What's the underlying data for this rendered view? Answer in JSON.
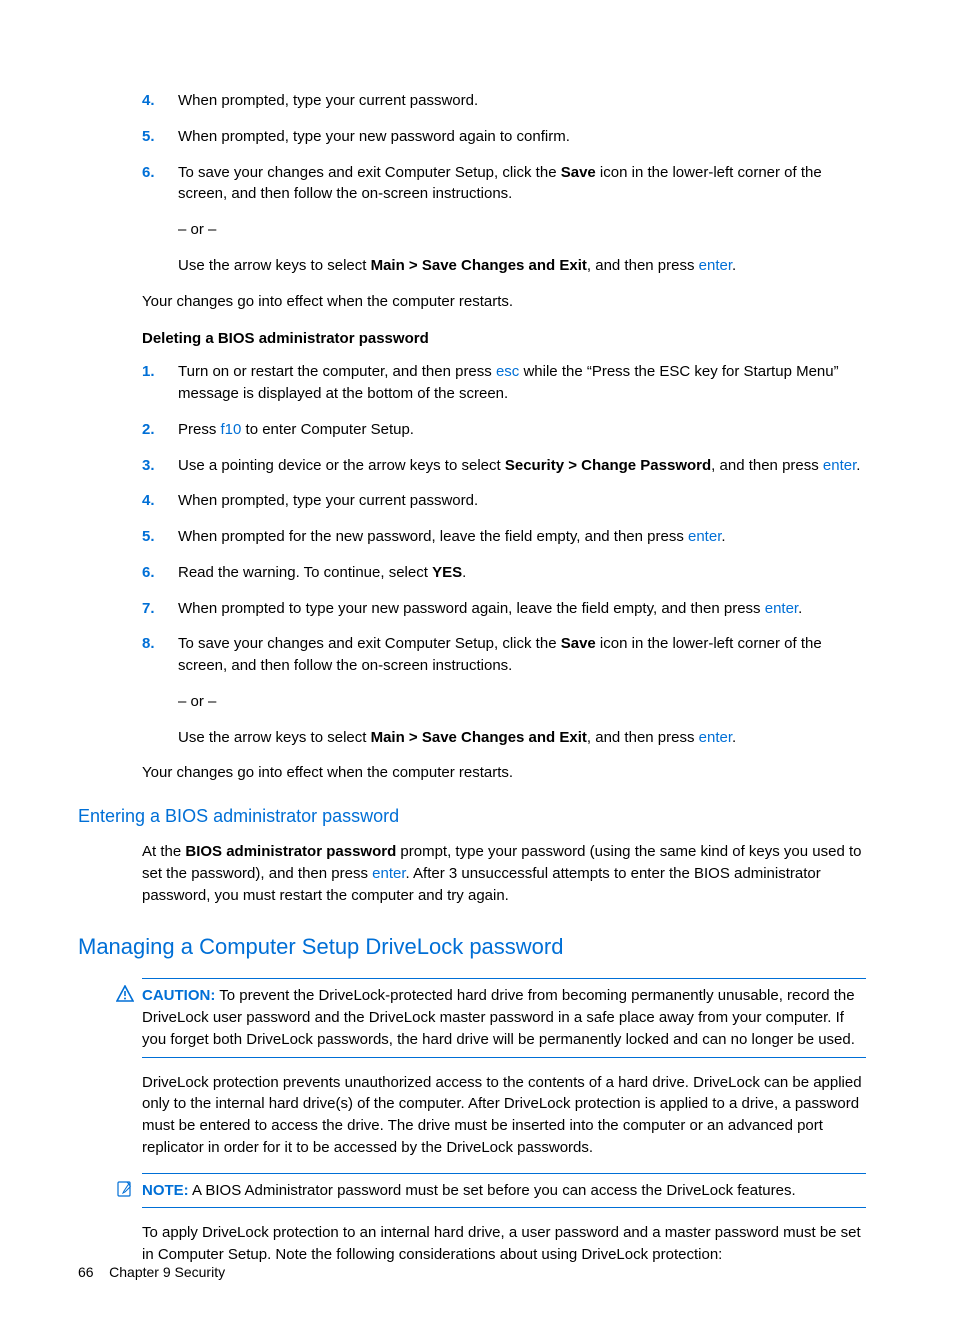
{
  "list1": {
    "items": [
      {
        "num": "4.",
        "html": "When prompted, type your current password."
      },
      {
        "num": "5.",
        "html": "When prompted, type your new password again to confirm."
      },
      {
        "num": "6.",
        "html": "To save your changes and exit Computer Setup, click the <span class=\"bold\">Save</span> icon in the lower-left corner of the screen, and then follow the on-screen instructions.<div class=\"sub\">– or –</div><div class=\"sub\">Use the arrow keys to select <span class=\"bold\">Main &gt; Save Changes and Exit</span>, and then press <span class=\"link\">enter</span>.</div>"
      }
    ]
  },
  "effect1": "Your changes go into effect when the computer restarts.",
  "subheading1": "Deleting a BIOS administrator password",
  "list2": {
    "items": [
      {
        "num": "1.",
        "html": "Turn on or restart the computer, and then press <span class=\"link\">esc</span> while the “Press the ESC key for Startup Menu” message is displayed at the bottom of the screen."
      },
      {
        "num": "2.",
        "html": "Press <span class=\"link\">f10</span> to enter Computer Setup."
      },
      {
        "num": "3.",
        "html": "Use a pointing device or the arrow keys to select <span class=\"bold\">Security &gt; Change Password</span>, and then press <span class=\"link\">enter</span>."
      },
      {
        "num": "4.",
        "html": "When prompted, type your current password."
      },
      {
        "num": "5.",
        "html": "When prompted for the new password, leave the field empty, and then press <span class=\"link\">enter</span>."
      },
      {
        "num": "6.",
        "html": "Read the warning. To continue, select <span class=\"bold\">YES</span>."
      },
      {
        "num": "7.",
        "html": "When prompted to type your new password again, leave the field empty, and then press <span class=\"link\">enter</span>."
      },
      {
        "num": "8.",
        "html": "To save your changes and exit Computer Setup, click the <span class=\"bold\">Save</span> icon in the lower-left corner of the screen, and then follow the on-screen instructions.<div class=\"sub\">– or –</div><div class=\"sub\">Use the arrow keys to select <span class=\"bold\">Main &gt; Save Changes and Exit</span>, and then press <span class=\"link\">enter</span>.</div>"
      }
    ]
  },
  "effect2": "Your changes go into effect when the computer restarts.",
  "h2a": "Entering a BIOS administrator password",
  "para_enter": "At the <span class=\"bold\">BIOS administrator password</span> prompt, type your password (using the same kind of keys you used to set the password), and then press <span class=\"link\">enter</span>. After 3 unsuccessful attempts to enter the BIOS administrator password, you must restart the computer and try again.",
  "h1a": "Managing a Computer Setup DriveLock password",
  "caution": {
    "label": "CAUTION:",
    "body": "To prevent the DriveLock-protected hard drive from becoming permanently unusable, record the DriveLock user password and the DriveLock master password in a safe place away from your computer. If you forget both DriveLock passwords, the hard drive will be permanently locked and can no longer be used."
  },
  "drivelock_p1": "DriveLock protection prevents unauthorized access to the contents of a hard drive. DriveLock can be applied only to the internal hard drive(s) of the computer. After DriveLock protection is applied to a drive, a password must be entered to access the drive. The drive must be inserted into the computer or an advanced port replicator in order for it to be accessed by the DriveLock passwords.",
  "note": {
    "label": "NOTE:",
    "body": "A BIOS Administrator password must be set before you can access the DriveLock features."
  },
  "drivelock_p2": "To apply DriveLock protection to an internal hard drive, a user password and a master password must be set in Computer Setup. Note the following considerations about using DriveLock protection:",
  "footer": {
    "pagenum": "66",
    "chapter": "Chapter 9   Security"
  }
}
